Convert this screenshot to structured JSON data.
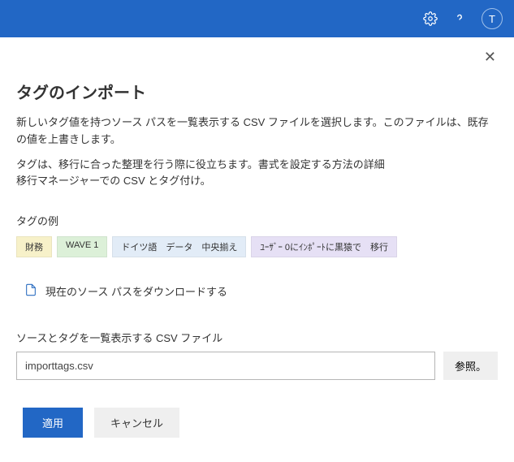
{
  "topbar": {
    "avatar_initial": "T"
  },
  "dialog": {
    "title": "タグのインポート",
    "desc1": "新しいタグ値を持つソース パスを一覧表示する CSV ファイルを選択します。このファイルは、既存の値を上書きします。",
    "desc2_a": "タグは、移行に合った整理を行う際に役立ちます。書式を設定する方法の詳細",
    "desc2_b": "移行マネージャーでの CSV とタグ付け。",
    "example_label": "タグの例",
    "tags": [
      "財務",
      "WAVE 1",
      "ドイツ語　データ　中央揃え",
      "ﾕｰｻﾞｰ 0にｲﾝﾎﾟｰﾄに黒猿で　移行"
    ],
    "download_label": "現在のソース パスをダウンロードする",
    "field_label": "ソースとタグを一覧表示する CSV ファイル",
    "filename": "importtags.csv",
    "browse": "参照。",
    "apply": "適用",
    "cancel": "キャンセル"
  }
}
